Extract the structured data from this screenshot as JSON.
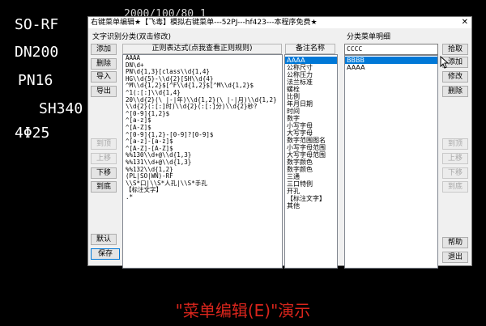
{
  "cad_texts": [
    "SO-RF",
    "DN200",
    "PN16",
    "SH340",
    "4Φ25"
  ],
  "cad_top_text": "2000/100/80 1",
  "window": {
    "title": "右键菜单编辑★【飞毒】模拟右键菜单---52PJ---hf423---本程序免费★",
    "close_glyph": "✕"
  },
  "left_group_label": "文字识别分类(双击修改)",
  "right_group_label": "分类菜单明细",
  "left_buttons": {
    "add": "添加",
    "delete": "删除",
    "import": "导入",
    "export": "导出",
    "top": "到顶",
    "up": "上移",
    "down": "下移",
    "bottom": "到底",
    "default": "默认",
    "save": "保存"
  },
  "right_buttons": {
    "pick": "拾取",
    "add": "添加",
    "modify": "修改",
    "delete": "删除",
    "top": "到顶",
    "up": "上移",
    "down": "下移",
    "bottom": "到底",
    "help": "帮助",
    "exit": "退出"
  },
  "regex_header": "正则表达式(点我查看正则规则)",
  "category_header": "备注名称",
  "regex_rows": [
    "AAAA",
    "DN\\d+",
    "PN\\d{1,3}[class\\\\d{1,4}",
    "HG\\\\d{5}-\\\\d{2}[SH\\\\d{4}",
    "^M\\\\d{1,2}$[^F\\\\d{1,2}$[^M\\\\d{1,2}$",
    "^1(:[:]\\\\d{1,4}",
    "20\\\\d{2}(\\ |-|年)\\\\d{1,2}(\\ |-|月)\\\\d{1,2}",
    "\\\\d{2}(:[:]时)\\\\d{2}(:[:]分)\\\\d{2}秒?",
    "^[0-9]{1,2}$",
    "^[a-z]$",
    "^[A-Z]$",
    "^[0-9]{1,2}-[0-9]?[0-9]$",
    "^[a-z]-[a-z]$",
    "^[A-Z]-[A-Z]$",
    "%%130\\\\d+@\\\\d{1,3}",
    "%%131\\\\d+@\\\\d{1,3}",
    "%%132\\\\d{1,2}",
    "(PL|SO|WN)-RF",
    "\\\\S*口|\\\\S*人孔|\\\\S*手孔",
    "【标注文字】",
    ".*"
  ],
  "category_rows": [
    "AAAA",
    "公称尺寸",
    "公称压力",
    "法兰标准",
    "螺栓",
    "比例",
    "年月日期",
    "时间",
    "数字",
    "小写字母",
    "大写字母",
    "数字范围图名",
    "小写字母范围",
    "大写字母范围",
    "数字颜色",
    "数字颜色",
    "三通",
    "三口特例",
    "开孔",
    "【标注文字】",
    "其他"
  ],
  "category_selected_index": 0,
  "detail_input": "CCCC",
  "detail_rows": [
    "BBBB",
    "AAAA"
  ],
  "detail_selected_index": 0,
  "caption": "\"菜单编辑(E)\"演示"
}
